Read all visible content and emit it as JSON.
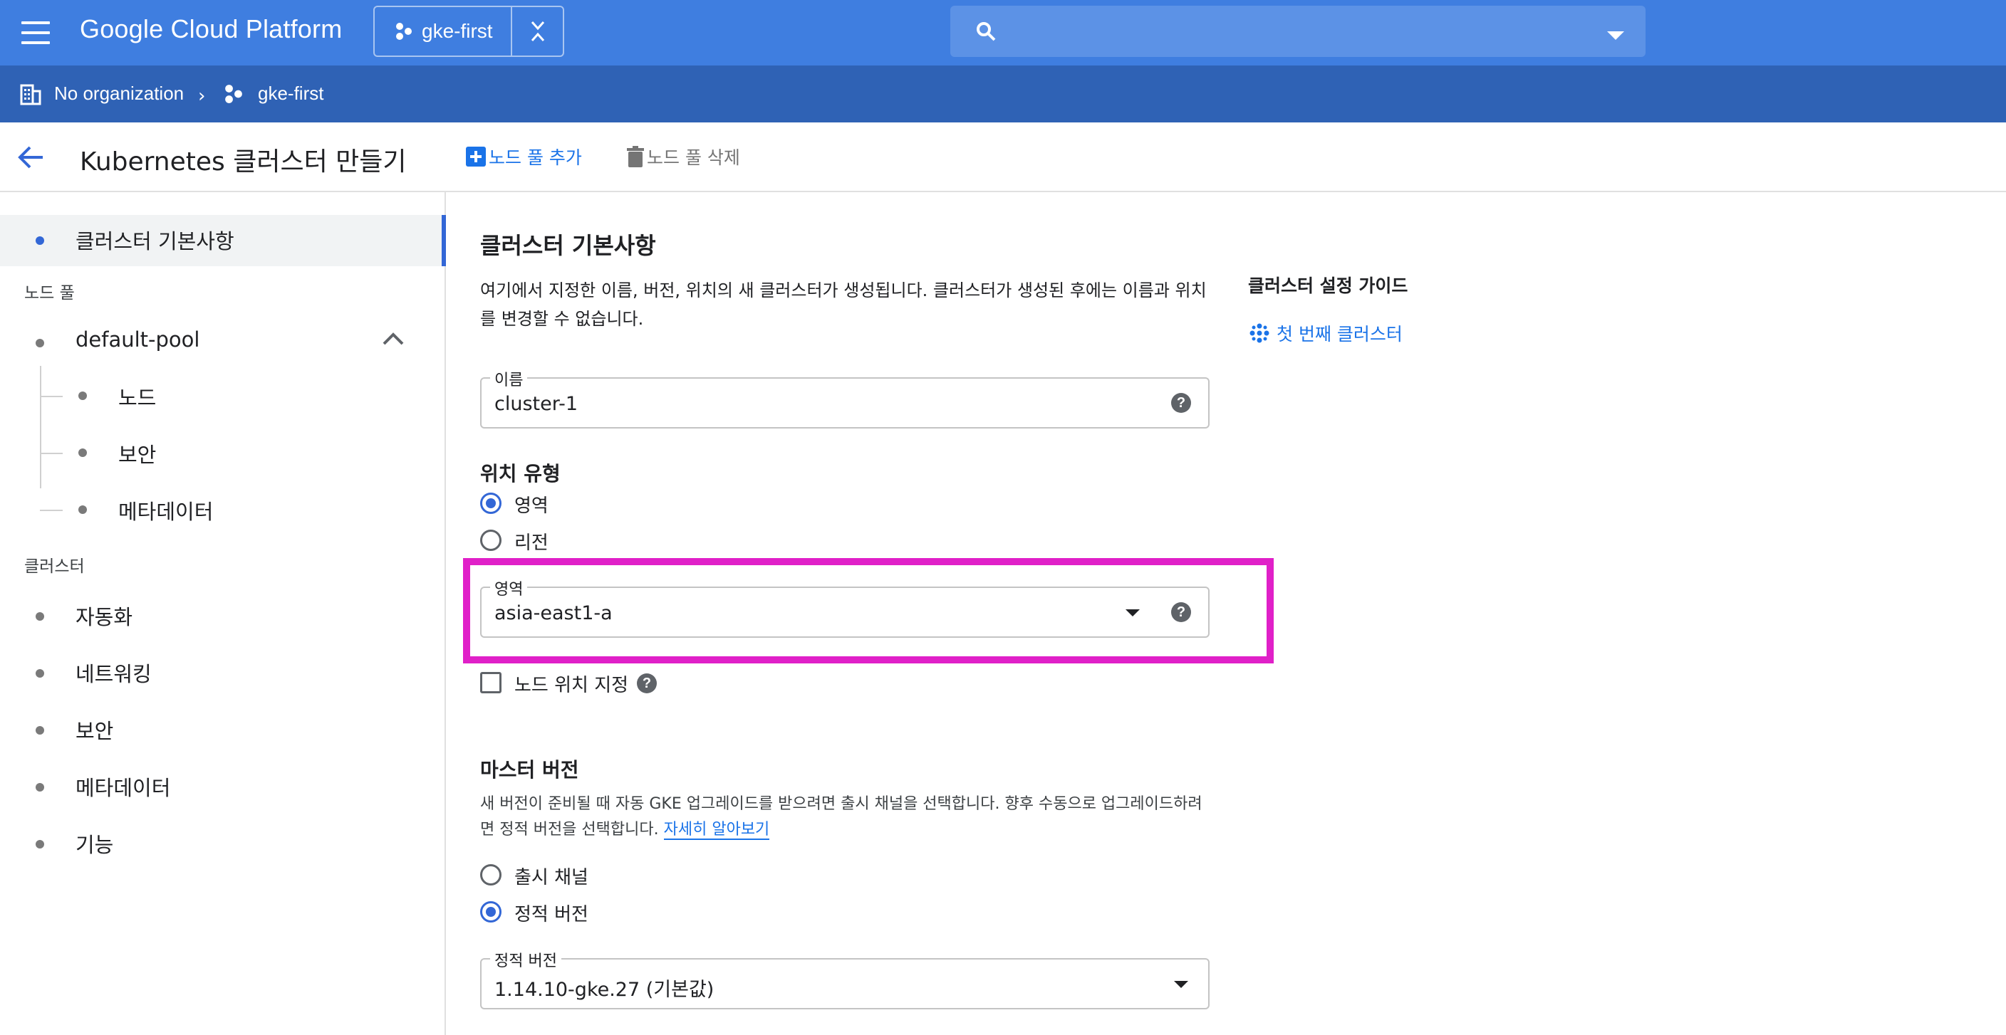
{
  "topbar": {
    "brand": "Google Cloud Platform",
    "project": "gke-first",
    "background": "#3f7ee0"
  },
  "breadcrumb": {
    "org": "No organization",
    "project": "gke-first"
  },
  "header": {
    "title": "Kubernetes 클러스터 만들기",
    "add_pool": "노드 풀 추가",
    "delete_pool": "노드 풀 삭제"
  },
  "sidebar": {
    "active": "클러스터 기본사항",
    "section_nodepool": "노드 풀",
    "pool_name": "default-pool",
    "pool_children": [
      "노드",
      "보안",
      "메타데이터"
    ],
    "section_cluster": "클러스터",
    "cluster_items": [
      "자동화",
      "네트워킹",
      "보안",
      "메타데이터",
      "기능"
    ]
  },
  "main": {
    "title": "클러스터 기본사항",
    "desc_line1": "여기에서 지정한 이름, 버전, 위치의 새 클러스터가 생성됩니다. 클러스터가 생성된 후에는 이름과 위치",
    "desc_line2": "를 변경할 수 없습니다.",
    "name_label": "이름",
    "name_value": "cluster-1",
    "location_type_title": "위치 유형",
    "location_options": [
      "영역",
      "리전"
    ],
    "location_selected": "영역",
    "zone_label": "영역",
    "zone_value": "asia-east1-a",
    "node_location_label": "노드 위치 지정",
    "master_version_title": "마스터 버전",
    "master_desc_line1": "새 버전이 준비될 때 자동 GKE 업그레이드를 받으려면 출시 채널을 선택합니다. 향후 수동으로 업그레이드하려",
    "master_desc_line2": "면 정적 버전을 선택합니다.",
    "learn_more": "자세히 알아보기",
    "version_options": [
      "출시 채널",
      "정적 버전"
    ],
    "version_selected": "정적 버전",
    "static_version_label": "정적 버전",
    "static_version_value": "1.14.10-gke.27 (기본값)"
  },
  "guide": {
    "title": "클러스터 설정 가이드",
    "link": "첫 번째 클러스터"
  },
  "colors": {
    "accent": "#3367d6",
    "highlight": "#e020c8",
    "crumbbar": "#2f62b5"
  }
}
